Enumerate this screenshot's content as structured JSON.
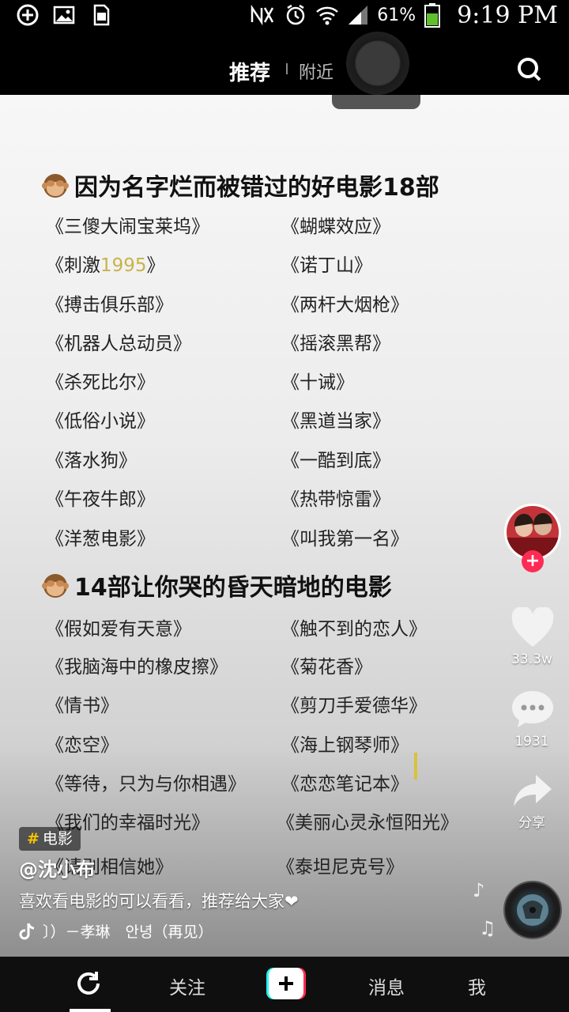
{
  "status_bar": {
    "battery_percent": "61%",
    "time": "9:19 PM"
  },
  "top_nav": {
    "tab_recommend": "推荐",
    "tab_nearby": "附近"
  },
  "content": {
    "list1": {
      "title": "因为名字烂而被错过的好电影18部",
      "left": [
        "《三傻大闹宝莱坞》",
        "《刺激",
        "《搏击俱乐部》",
        "《机器人总动员》",
        "《杀死比尔》",
        "《低俗小说》",
        "《落水狗》",
        "《午夜牛郎》",
        "《洋葱电影》"
      ],
      "left_2_num": "1995",
      "left_2_end": "》",
      "right": [
        "《蝴蝶效应》",
        "《诺丁山》",
        "《两杆大烟枪》",
        "《摇滚黑帮》",
        "《十诫》",
        "《黑道当家》",
        "《一酷到底》",
        "《热带惊雷》",
        "《叫我第一名》"
      ]
    },
    "list2": {
      "title": "14部让你哭的昏天暗地的电影",
      "left": [
        "《假如爱有天意》",
        "《我脑海中的橡皮擦》",
        "《情书》",
        "《恋空》",
        "《等待，只为与你相遇》",
        "《我们的幸福时光》",
        "《请别相信她》"
      ],
      "right": [
        "《触不到的恋人》",
        "《菊花香》",
        "《剪刀手爱德华》",
        "《海上钢琴师》",
        "《恋恋笔记本》",
        "《美丽心灵永恒阳光》",
        "《泰坦尼克号》"
      ]
    }
  },
  "side_rail": {
    "likes": "33.3w",
    "comments": "1931",
    "share": "分享"
  },
  "caption": {
    "tag": "电影",
    "author": "@沈小布",
    "description": "喜欢看电影的可以看看，推荐给大家❤",
    "music": "〕）－孝琳　안녕（再见）"
  },
  "bottom_nav": {
    "follow": "关注",
    "messages": "消息",
    "me": "我"
  },
  "colors": {
    "accent_red": "#fe2c55",
    "accent_cyan": "#25f4ee",
    "tag_yellow": "#f5c400",
    "highlight": "#c9b24a"
  }
}
